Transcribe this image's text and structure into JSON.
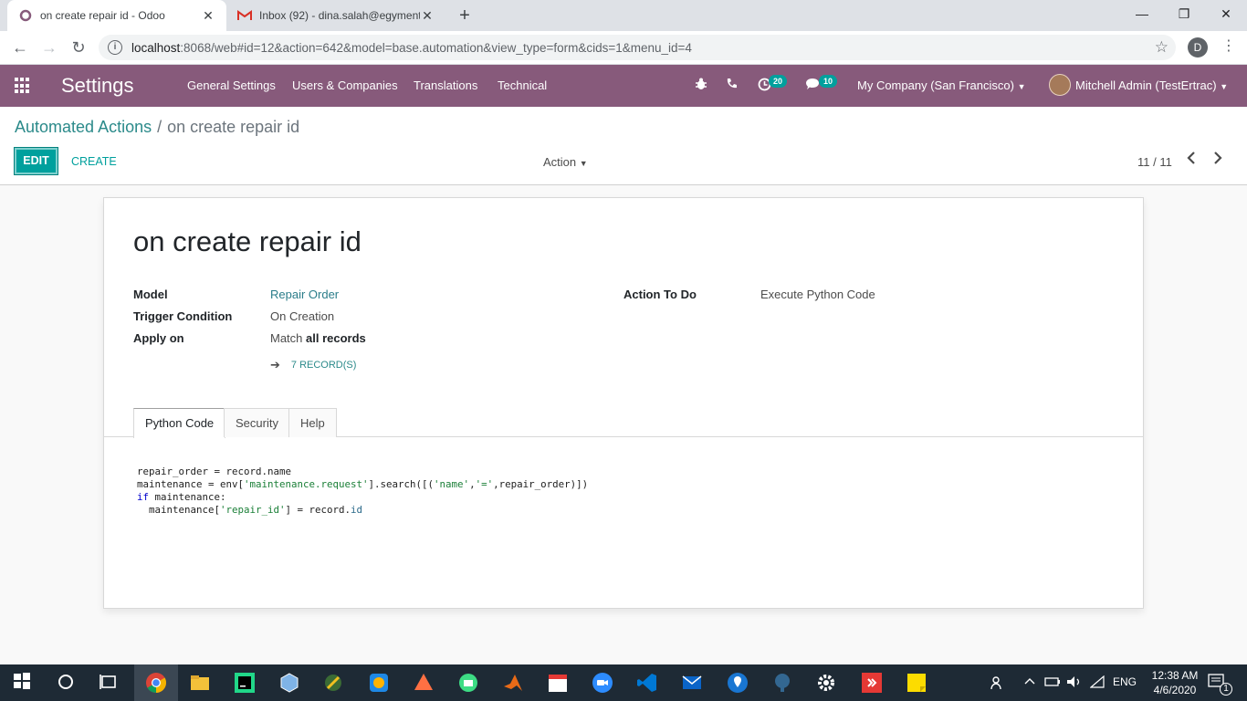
{
  "browser": {
    "tabs": [
      {
        "title": "on create repair id - Odoo",
        "icon": "odoo-icon",
        "active": true
      },
      {
        "title": "Inbox (92) - dina.salah@egyment",
        "icon": "gmail-icon",
        "active": false
      }
    ],
    "url_host": "localhost",
    "url_rest": ":8068/web#id=12&action=642&model=base.automation&view_type=form&cids=1&menu_id=4",
    "profile_initial": "D"
  },
  "navbar": {
    "app_title": "Settings",
    "menu": [
      "General Settings",
      "Users & Companies",
      "Translations",
      "Technical"
    ],
    "activity_count": "20",
    "message_count": "10",
    "company": "My Company (San Francisco)",
    "user": "Mitchell Admin (TestErtrac)"
  },
  "control_panel": {
    "breadcrumb_parent": "Automated Actions",
    "breadcrumb_separator": "/",
    "breadcrumb_current": "on create repair id",
    "edit_label": "EDIT",
    "create_label": "CREATE",
    "action_label": "Action",
    "pager": "11 / 11"
  },
  "form": {
    "title": "on create repair id",
    "fields": {
      "model_label": "Model",
      "model_value": "Repair Order",
      "trigger_label": "Trigger Condition",
      "trigger_value": "On Creation",
      "apply_label": "Apply on",
      "apply_prefix": "Match",
      "apply_value": "all records",
      "action_label": "Action To Do",
      "action_value": "Execute Python Code"
    },
    "records_button": "7 RECORD(S)",
    "tabs": [
      "Python Code",
      "Security",
      "Help"
    ],
    "code_lines": [
      "repair_order = record.name",
      "maintenance = env['maintenance.request'].search([('name','=',repair_order)])",
      "if maintenance:",
      "  maintenance['repair_id'] = record.id"
    ]
  },
  "taskbar": {
    "language": "ENG",
    "time": "12:38 AM",
    "date": "4/6/2020",
    "notification_count": "1"
  },
  "colors": {
    "odoo_purple": "#875a7b",
    "odoo_teal": "#00a09d"
  }
}
